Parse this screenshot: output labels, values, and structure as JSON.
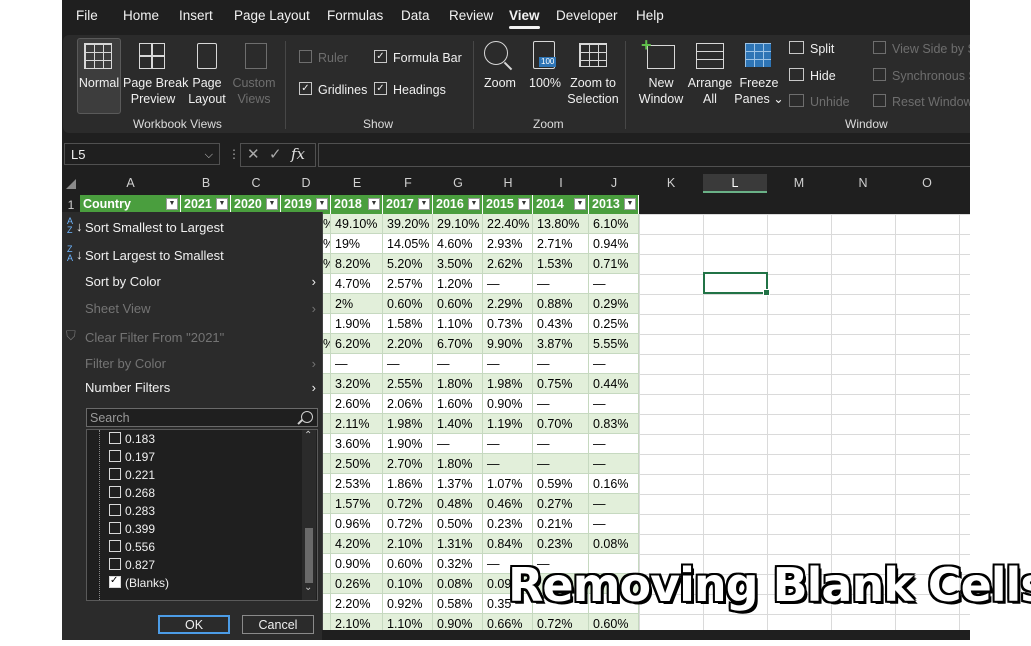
{
  "menu_tabs": [
    "File",
    "Home",
    "Insert",
    "Page Layout",
    "Formulas",
    "Data",
    "Review",
    "View",
    "Developer",
    "Help"
  ],
  "active_tab": "View",
  "ribbon": {
    "workbook_views": {
      "label": "Workbook Views",
      "normal": "Normal",
      "page_break_1": "Page Break",
      "page_break_2": "Preview",
      "page_layout_1": "Page",
      "page_layout_2": "Layout",
      "custom_1": "Custom",
      "custom_2": "Views"
    },
    "show": {
      "label": "Show",
      "ruler": "Ruler",
      "formula_bar": "Formula Bar",
      "gridlines": "Gridlines",
      "headings": "Headings"
    },
    "zoom": {
      "label": "Zoom",
      "zoom": "Zoom",
      "pct": "100%",
      "pct_icon": "100",
      "zoom_sel_1": "Zoom to",
      "zoom_sel_2": "Selection"
    },
    "window": {
      "label": "Window",
      "new_1": "New",
      "new_2": "Window",
      "arrange_1": "Arrange",
      "arrange_2": "All",
      "freeze_1": "Freeze",
      "freeze_2": "Panes ⌄",
      "split": "Split",
      "hide": "Hide",
      "unhide": "Unhide",
      "side_by_side": "View Side by Si",
      "sync": "Synchronous S",
      "reset": "Reset Window"
    }
  },
  "name_box": "L5",
  "fx": "fx",
  "columns": [
    "A",
    "B",
    "C",
    "D",
    "E",
    "F",
    "G",
    "H",
    "I",
    "J",
    "K",
    "L",
    "M",
    "N",
    "O"
  ],
  "selected_column": "L",
  "row_number": "1",
  "headers": [
    "Country",
    "2021",
    "2020",
    "2019",
    "2018",
    "2017",
    "2016",
    "2015",
    "2014",
    "2013"
  ],
  "rows": [
    [
      "%",
      "49.10%",
      "39.20%",
      "29.10%",
      "22.40%",
      "13.80%",
      "6.10%"
    ],
    [
      "%",
      "19%",
      "14.05%",
      "4.60%",
      "2.93%",
      "2.71%",
      "0.94%"
    ],
    [
      "%",
      "8.20%",
      "5.20%",
      "3.50%",
      "2.62%",
      "1.53%",
      "0.71%"
    ],
    [
      "",
      "4.70%",
      "2.57%",
      "1.20%",
      "—",
      "—",
      "—"
    ],
    [
      "",
      "2%",
      "0.60%",
      "0.60%",
      "2.29%",
      "0.88%",
      "0.29%"
    ],
    [
      "",
      "1.90%",
      "1.58%",
      "1.10%",
      "0.73%",
      "0.43%",
      "0.25%"
    ],
    [
      "%",
      "6.20%",
      "2.20%",
      "6.70%",
      "9.90%",
      "3.87%",
      "5.55%"
    ],
    [
      "",
      "—",
      "—",
      "—",
      "—",
      "—",
      "—"
    ],
    [
      "",
      "3.20%",
      "2.55%",
      "1.80%",
      "1.98%",
      "0.75%",
      "0.44%"
    ],
    [
      "",
      "2.60%",
      "2.06%",
      "1.60%",
      "0.90%",
      "—",
      "—"
    ],
    [
      "",
      "2.11%",
      "1.98%",
      "1.40%",
      "1.19%",
      "0.70%",
      "0.83%"
    ],
    [
      "",
      "3.60%",
      "1.90%",
      "—",
      "—",
      "—",
      "—"
    ],
    [
      "",
      "2.50%",
      "2.70%",
      "1.80%",
      "—",
      "—",
      "—"
    ],
    [
      "",
      "2.53%",
      "1.86%",
      "1.37%",
      "1.07%",
      "0.59%",
      "0.16%"
    ],
    [
      "",
      "1.57%",
      "0.72%",
      "0.48%",
      "0.46%",
      "0.27%",
      "—"
    ],
    [
      "",
      "0.96%",
      "0.72%",
      "0.50%",
      "0.23%",
      "0.21%",
      "—"
    ],
    [
      "",
      "4.20%",
      "2.10%",
      "1.31%",
      "0.84%",
      "0.23%",
      "0.08%"
    ],
    [
      "",
      "0.90%",
      "0.60%",
      "0.32%",
      "—",
      "—",
      ""
    ],
    [
      "",
      "0.26%",
      "0.10%",
      "0.08%",
      "0.09",
      "",
      ""
    ],
    [
      "",
      "2.20%",
      "0.92%",
      "0.58%",
      "0.35",
      "",
      ""
    ],
    [
      "",
      "2.10%",
      "1.10%",
      "0.90%",
      "0.66%",
      "0.72%",
      "0.60%"
    ]
  ],
  "filter_menu": {
    "sort_asc": "Sort Smallest to Largest",
    "sort_desc": "Sort Largest to Smallest",
    "sort_color": "Sort by Color",
    "sheet_view": "Sheet View",
    "clear_filter": "Clear Filter From \"2021\"",
    "filter_color": "Filter by Color",
    "number_filters": "Number Filters",
    "search_placeholder": "Search",
    "list": [
      {
        "label": "0.183",
        "checked": false
      },
      {
        "label": "0.197",
        "checked": false
      },
      {
        "label": "0.221",
        "checked": false
      },
      {
        "label": "0.268",
        "checked": false
      },
      {
        "label": "0.283",
        "checked": false
      },
      {
        "label": "0.399",
        "checked": false
      },
      {
        "label": "0.556",
        "checked": false
      },
      {
        "label": "0.827",
        "checked": false
      },
      {
        "label": "(Blanks)",
        "checked": true
      }
    ],
    "ok": "OK",
    "cancel": "Cancel"
  },
  "overlay_caption": "Removing Blank Cells",
  "colors": {
    "header_green": "#4a9e3e",
    "band_green": "#e2efda",
    "selection_green": "#217346",
    "ribbon_dark": "#2b2b2b",
    "chrome_dark": "#1f1f1f"
  }
}
